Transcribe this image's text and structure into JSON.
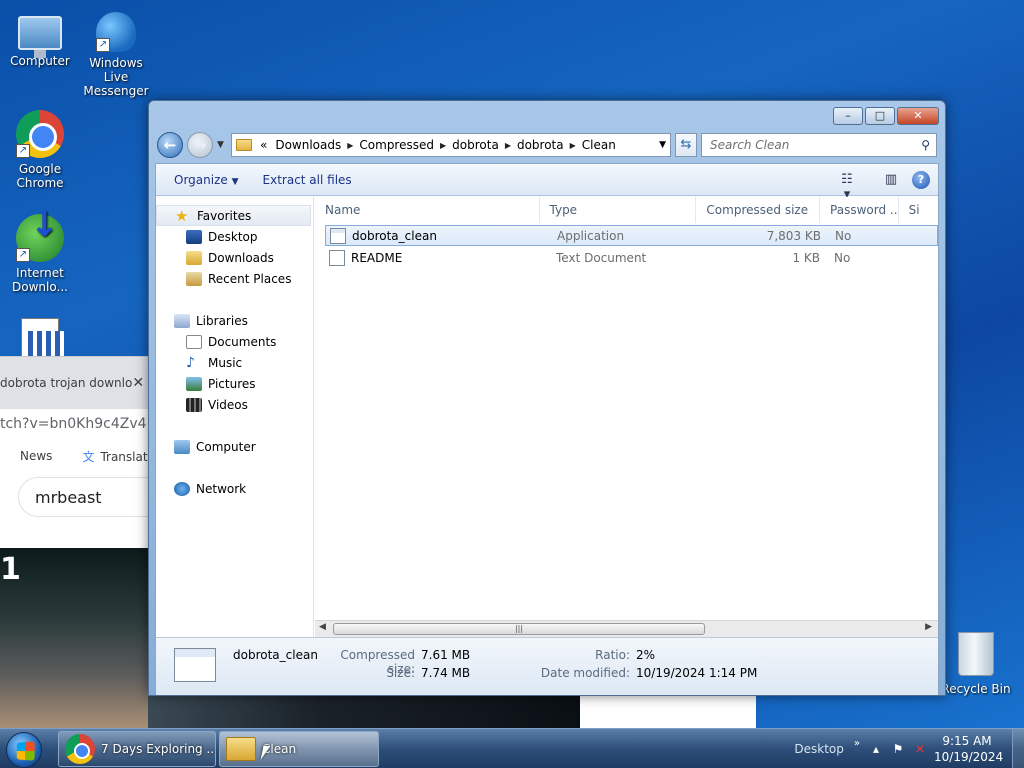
{
  "desktop": {
    "icons": [
      {
        "label": "Computer",
        "icon": "computer-icon"
      },
      {
        "label": "Windows Live Messenger",
        "icon": "messenger-icon"
      },
      {
        "label": "Google Chrome",
        "icon": "chrome-icon"
      },
      {
        "label": "Internet Downlo...",
        "icon": "idm-icon"
      },
      {
        "label": "Recycle Bin",
        "icon": "recycle-bin-icon"
      }
    ]
  },
  "background_browser": {
    "tab_title": "dobrota trojan downlo",
    "url_fragment": "tch?v=bn0Kh9c4Zv4",
    "bookmarks": [
      "News",
      "Translate"
    ],
    "search_text": "mrbeast",
    "video_char": "1"
  },
  "explorer": {
    "controls": {
      "minimize": "–",
      "maximize": "□",
      "close": "✕"
    },
    "breadcrumb": {
      "overflow": "«",
      "items": [
        "Downloads",
        "Compressed",
        "dobrota",
        "dobrota",
        "Clean"
      ]
    },
    "search_placeholder": "Search Clean",
    "toolbar": {
      "organize": "Organize",
      "extract": "Extract all files"
    },
    "nav": {
      "favorites": "Favorites",
      "favorites_items": [
        "Desktop",
        "Downloads",
        "Recent Places"
      ],
      "libraries": "Libraries",
      "libraries_items": [
        "Documents",
        "Music",
        "Pictures",
        "Videos"
      ],
      "computer": "Computer",
      "network": "Network"
    },
    "columns": [
      "Name",
      "Type",
      "Compressed size",
      "Password ...",
      "Si"
    ],
    "files": [
      {
        "name": "dobrota_clean",
        "type": "Application",
        "size": "7,803 KB",
        "password": "No"
      },
      {
        "name": "README",
        "type": "Text Document",
        "size": "1 KB",
        "password": "No"
      }
    ],
    "details": {
      "name": "dobrota_clean",
      "compressed_label": "Compressed size:",
      "compressed_value": "7.61 MB",
      "size_label": "Size:",
      "size_value": "7.74 MB",
      "ratio_label": "Ratio:",
      "ratio_value": "2%",
      "date_label": "Date modified:",
      "date_value": "10/19/2024 1:14 PM"
    }
  },
  "taskbar": {
    "buttons": [
      "7 Days Exploring ...",
      "Clean"
    ],
    "desktop_label": "Desktop",
    "time": "9:15 AM",
    "date": "10/19/2024"
  }
}
